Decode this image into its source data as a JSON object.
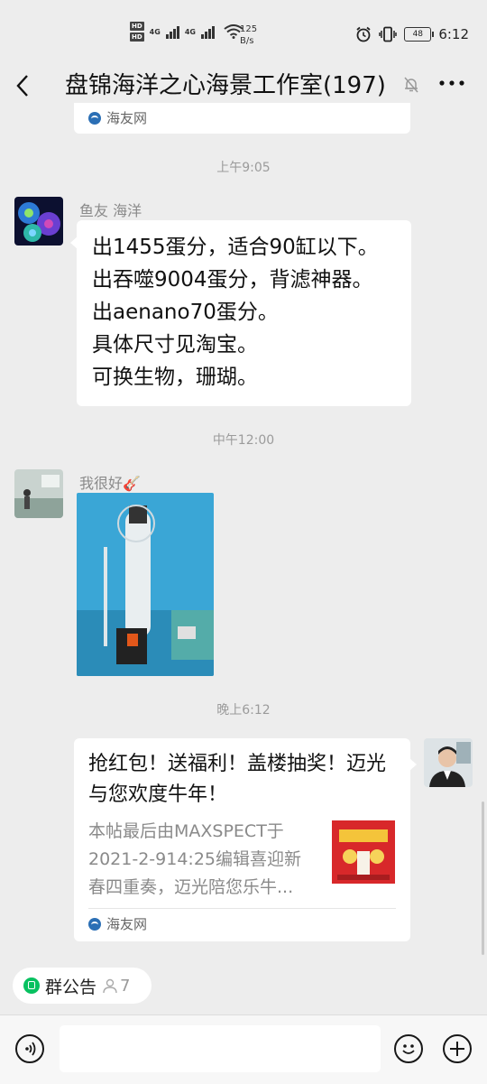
{
  "status_bar": {
    "hd_badges": [
      "HD",
      "HD"
    ],
    "net_type_1": "4G",
    "net_type_2": "4G",
    "speed_value": "125",
    "speed_unit": "B/s",
    "battery": "48",
    "time": "6:12"
  },
  "header": {
    "back_icon": "chevron-left-icon",
    "title": "盘锦海洋之心海景工作室(197)",
    "mute_icon": "bell-off-icon",
    "more_icon": "more-dots-icon"
  },
  "chat": {
    "top_card_source": "海友网",
    "messages": [
      {
        "time": "上午9:05",
        "sender": "鱼友 海洋",
        "lines": [
          "出1455蛋分，适合90缸以下。",
          "出吞噬9004蛋分，背滤神器。",
          "出aenano70蛋分。",
          "具体尺寸见淘宝。",
          "可换生物，珊瑚。"
        ]
      },
      {
        "time": "中午12:00",
        "sender": "我很好🎸",
        "image_alt": "protein skimmer photo"
      },
      {
        "time": "晚上6:12",
        "card_title": "抢红包！送福利！盖楼抽奖！迈光与您欢度牛年！",
        "card_desc_lines": [
          "本帖最后由MAXSPECT于",
          "2021-2-914:25编辑喜迎新",
          "春四重奏，迈光陪您乐牛..."
        ],
        "card_source": "海友网"
      }
    ]
  },
  "bottom": {
    "notice_label": "群公告",
    "notice_count": "7",
    "voice_icon": "voice-icon",
    "emoji_icon": "emoji-icon",
    "plus_icon": "plus-icon",
    "input_placeholder": ""
  },
  "colors": {
    "background": "#ededed",
    "bubble": "#ffffff",
    "accent_green": "#07c160",
    "timestamp_gray": "#9b9b9b"
  }
}
